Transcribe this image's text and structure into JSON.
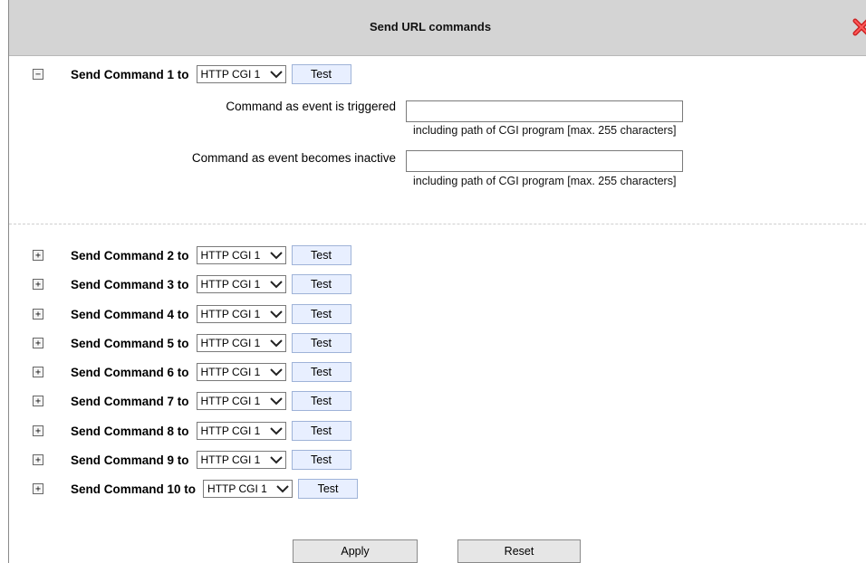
{
  "dialog": {
    "title": "Send URL commands"
  },
  "commands": [
    {
      "label": "Send Command 1 to",
      "target": "HTTP CGI 1",
      "test": "Test",
      "expanded": true
    },
    {
      "label": "Send Command 2 to",
      "target": "HTTP CGI 1",
      "test": "Test",
      "expanded": false
    },
    {
      "label": "Send Command 3 to",
      "target": "HTTP CGI 1",
      "test": "Test",
      "expanded": false
    },
    {
      "label": "Send Command 4 to",
      "target": "HTTP CGI 1",
      "test": "Test",
      "expanded": false
    },
    {
      "label": "Send Command 5 to",
      "target": "HTTP CGI 1",
      "test": "Test",
      "expanded": false
    },
    {
      "label": "Send Command 6 to",
      "target": "HTTP CGI 1",
      "test": "Test",
      "expanded": false
    },
    {
      "label": "Send Command 7 to",
      "target": "HTTP CGI 1",
      "test": "Test",
      "expanded": false
    },
    {
      "label": "Send Command 8 to",
      "target": "HTTP CGI 1",
      "test": "Test",
      "expanded": false
    },
    {
      "label": "Send Command 9 to",
      "target": "HTTP CGI 1",
      "test": "Test",
      "expanded": false
    },
    {
      "label": "Send Command 10 to",
      "target": "HTTP CGI 1",
      "test": "Test",
      "expanded": false
    }
  ],
  "command1_details": {
    "triggered_label": "Command as event is triggered",
    "triggered_value": "",
    "triggered_hint": "including path of CGI program [max. 255 characters]",
    "inactive_label": "Command as event becomes inactive",
    "inactive_value": "",
    "inactive_hint": "including path of CGI program [max. 255 characters]"
  },
  "buttons": {
    "apply": "Apply",
    "reset": "Reset"
  },
  "icons": {
    "close": "close-x-icon",
    "collapse": "minus-box-icon",
    "expand": "plus-box-icon",
    "dropdown": "chevron-down-icon"
  },
  "colors": {
    "titlebar": "#d4d4d4",
    "test_button": "#e8efff",
    "close_red": "#cc2222"
  }
}
